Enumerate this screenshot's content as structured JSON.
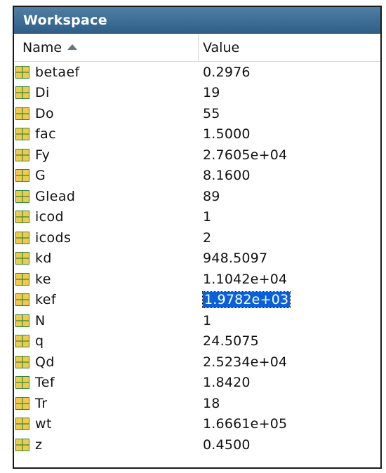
{
  "panel": {
    "title": "Workspace"
  },
  "columns": {
    "name": "Name",
    "value": "Value",
    "sort_icon": "sort-ascending-icon"
  },
  "variables": [
    {
      "name": "betaef",
      "value": "0.2976"
    },
    {
      "name": "Di",
      "value": "19"
    },
    {
      "name": "Do",
      "value": "55"
    },
    {
      "name": "fac",
      "value": "1.5000"
    },
    {
      "name": "Fy",
      "value": "2.7605e+04"
    },
    {
      "name": "G",
      "value": "8.1600"
    },
    {
      "name": "Glead",
      "value": "89"
    },
    {
      "name": "icod",
      "value": "1"
    },
    {
      "name": "icods",
      "value": "2"
    },
    {
      "name": "kd",
      "value": "948.5097"
    },
    {
      "name": "ke",
      "value": "1.1042e+04"
    },
    {
      "name": "kef",
      "value": "1.9782e+03",
      "selected": true
    },
    {
      "name": "N",
      "value": "1"
    },
    {
      "name": "q",
      "value": "24.5075"
    },
    {
      "name": "Qd",
      "value": "2.5234e+04"
    },
    {
      "name": "Tef",
      "value": "1.8420"
    },
    {
      "name": "Tr",
      "value": "18"
    },
    {
      "name": "wt",
      "value": "1.6661e+05"
    },
    {
      "name": "z",
      "value": "0.4500"
    }
  ],
  "colors": {
    "title_bar": "#2f5f86",
    "icon_fill": "#f2c94c",
    "icon_grid": "#2e8b3a",
    "selection": "#0a60d8"
  },
  "icons": {
    "variable": "matrix-grid-icon"
  }
}
